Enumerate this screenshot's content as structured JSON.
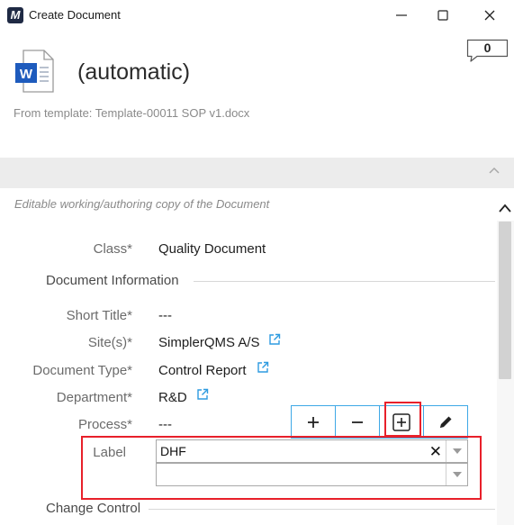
{
  "window": {
    "logo_letter": "M",
    "title": "Create Document"
  },
  "header": {
    "doc_name": "(automatic)",
    "template_line": "From template: Template-00011 SOP v1.docx",
    "comment_count": "0"
  },
  "note": "Editable working/authoring copy of the Document",
  "fields": {
    "class_label": "Class*",
    "class_value": "Quality Document",
    "section_doc_info": "Document Information",
    "short_title_label": "Short Title*",
    "short_title_value": "---",
    "sites_label": "Site(s)*",
    "sites_value": "SimplerQMS A/S",
    "doc_type_label": "Document Type*",
    "doc_type_value": "Control Report",
    "department_label": "Department*",
    "department_value": "R&D",
    "process_label": "Process*",
    "process_value": "---",
    "label_label": "Label",
    "label_value_1": "DHF",
    "label_value_2": "",
    "section_change_control": "Change Control"
  },
  "icons": {
    "logo": "app-logo-icon",
    "minimize": "minimize-icon",
    "maximize": "maximize-icon",
    "close": "close-icon",
    "word": "word-document-icon",
    "comment": "comment-bubble-icon",
    "collapse": "chevron-up-icon",
    "external": "external-link-icon",
    "add": "plus-icon",
    "remove": "minus-icon",
    "add_boxed": "plus-square-icon",
    "edit": "pencil-icon",
    "clear": "clear-x-icon",
    "dropdown": "chevron-down-icon"
  },
  "colors": {
    "accent_blue": "#3ea8e6",
    "highlight_red": "#e8202a",
    "word_blue": "#1e5bbd"
  }
}
